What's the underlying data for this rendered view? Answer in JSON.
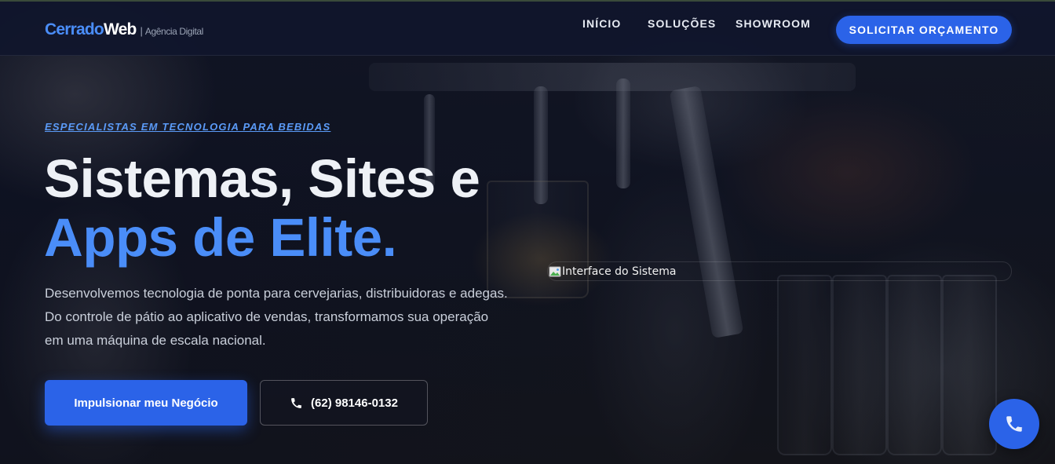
{
  "header": {
    "logo_primary": "Cerrado",
    "logo_secondary": "Web",
    "logo_separator": "|",
    "logo_tagline": "Agência Digital",
    "nav": [
      {
        "label": "INÍCIO"
      },
      {
        "label": "SOLUÇÕES"
      },
      {
        "label": "SHOWROOM"
      }
    ],
    "cta_label": "SOLICITAR ORÇAMENTO"
  },
  "hero": {
    "eyebrow": "ESPECIALISTAS EM TECNOLOGIA PARA BEBIDAS",
    "headline_line1": "Sistemas, Sites e",
    "headline_line2": "Apps de Elite.",
    "lead": "Desenvolvemos tecnologia de ponta para cervejarias, distribuidoras e adegas. Do controle de pátio ao aplicativo de vendas, transformamos sua operação em uma máquina de escala nacional.",
    "primary_button": "Impulsionar meu Negócio",
    "phone_button": "(62) 98146-0132",
    "image_alt": "Interface do Sistema"
  },
  "icons": {
    "phone": "phone-icon",
    "broken_image": "broken-image-icon",
    "call_fab": "phone-icon"
  },
  "colors": {
    "accent": "#2b63e8",
    "highlight": "#4a8df8",
    "navbar_bg": "#10162c",
    "text": "#e8ecf3"
  }
}
